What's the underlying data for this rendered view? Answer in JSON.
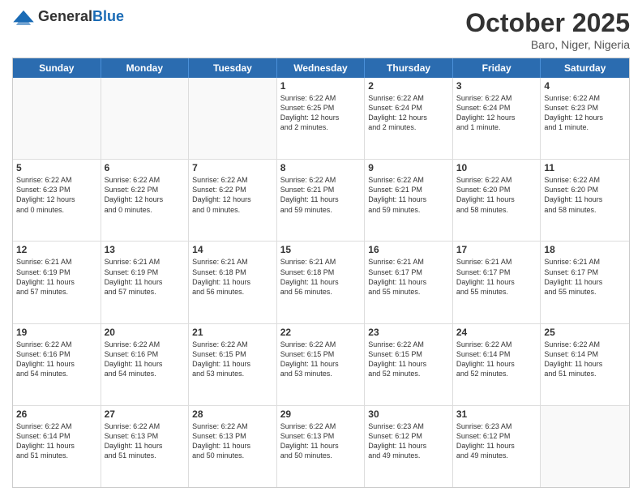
{
  "header": {
    "logo_general": "General",
    "logo_blue": "Blue",
    "title": "October 2025",
    "subtitle": "Baro, Niger, Nigeria"
  },
  "days": [
    "Sunday",
    "Monday",
    "Tuesday",
    "Wednesday",
    "Thursday",
    "Friday",
    "Saturday"
  ],
  "rows": [
    [
      {
        "day": "",
        "empty": true
      },
      {
        "day": "",
        "empty": true
      },
      {
        "day": "",
        "empty": true
      },
      {
        "day": "1",
        "text": "Sunrise: 6:22 AM\nSunset: 6:25 PM\nDaylight: 12 hours\nand 2 minutes."
      },
      {
        "day": "2",
        "text": "Sunrise: 6:22 AM\nSunset: 6:24 PM\nDaylight: 12 hours\nand 2 minutes."
      },
      {
        "day": "3",
        "text": "Sunrise: 6:22 AM\nSunset: 6:24 PM\nDaylight: 12 hours\nand 1 minute."
      },
      {
        "day": "4",
        "text": "Sunrise: 6:22 AM\nSunset: 6:23 PM\nDaylight: 12 hours\nand 1 minute."
      }
    ],
    [
      {
        "day": "5",
        "text": "Sunrise: 6:22 AM\nSunset: 6:23 PM\nDaylight: 12 hours\nand 0 minutes."
      },
      {
        "day": "6",
        "text": "Sunrise: 6:22 AM\nSunset: 6:22 PM\nDaylight: 12 hours\nand 0 minutes."
      },
      {
        "day": "7",
        "text": "Sunrise: 6:22 AM\nSunset: 6:22 PM\nDaylight: 12 hours\nand 0 minutes."
      },
      {
        "day": "8",
        "text": "Sunrise: 6:22 AM\nSunset: 6:21 PM\nDaylight: 11 hours\nand 59 minutes."
      },
      {
        "day": "9",
        "text": "Sunrise: 6:22 AM\nSunset: 6:21 PM\nDaylight: 11 hours\nand 59 minutes."
      },
      {
        "day": "10",
        "text": "Sunrise: 6:22 AM\nSunset: 6:20 PM\nDaylight: 11 hours\nand 58 minutes."
      },
      {
        "day": "11",
        "text": "Sunrise: 6:22 AM\nSunset: 6:20 PM\nDaylight: 11 hours\nand 58 minutes."
      }
    ],
    [
      {
        "day": "12",
        "text": "Sunrise: 6:21 AM\nSunset: 6:19 PM\nDaylight: 11 hours\nand 57 minutes."
      },
      {
        "day": "13",
        "text": "Sunrise: 6:21 AM\nSunset: 6:19 PM\nDaylight: 11 hours\nand 57 minutes."
      },
      {
        "day": "14",
        "text": "Sunrise: 6:21 AM\nSunset: 6:18 PM\nDaylight: 11 hours\nand 56 minutes."
      },
      {
        "day": "15",
        "text": "Sunrise: 6:21 AM\nSunset: 6:18 PM\nDaylight: 11 hours\nand 56 minutes."
      },
      {
        "day": "16",
        "text": "Sunrise: 6:21 AM\nSunset: 6:17 PM\nDaylight: 11 hours\nand 55 minutes."
      },
      {
        "day": "17",
        "text": "Sunrise: 6:21 AM\nSunset: 6:17 PM\nDaylight: 11 hours\nand 55 minutes."
      },
      {
        "day": "18",
        "text": "Sunrise: 6:21 AM\nSunset: 6:17 PM\nDaylight: 11 hours\nand 55 minutes."
      }
    ],
    [
      {
        "day": "19",
        "text": "Sunrise: 6:22 AM\nSunset: 6:16 PM\nDaylight: 11 hours\nand 54 minutes."
      },
      {
        "day": "20",
        "text": "Sunrise: 6:22 AM\nSunset: 6:16 PM\nDaylight: 11 hours\nand 54 minutes."
      },
      {
        "day": "21",
        "text": "Sunrise: 6:22 AM\nSunset: 6:15 PM\nDaylight: 11 hours\nand 53 minutes."
      },
      {
        "day": "22",
        "text": "Sunrise: 6:22 AM\nSunset: 6:15 PM\nDaylight: 11 hours\nand 53 minutes."
      },
      {
        "day": "23",
        "text": "Sunrise: 6:22 AM\nSunset: 6:15 PM\nDaylight: 11 hours\nand 52 minutes."
      },
      {
        "day": "24",
        "text": "Sunrise: 6:22 AM\nSunset: 6:14 PM\nDaylight: 11 hours\nand 52 minutes."
      },
      {
        "day": "25",
        "text": "Sunrise: 6:22 AM\nSunset: 6:14 PM\nDaylight: 11 hours\nand 51 minutes."
      }
    ],
    [
      {
        "day": "26",
        "text": "Sunrise: 6:22 AM\nSunset: 6:14 PM\nDaylight: 11 hours\nand 51 minutes."
      },
      {
        "day": "27",
        "text": "Sunrise: 6:22 AM\nSunset: 6:13 PM\nDaylight: 11 hours\nand 51 minutes."
      },
      {
        "day": "28",
        "text": "Sunrise: 6:22 AM\nSunset: 6:13 PM\nDaylight: 11 hours\nand 50 minutes."
      },
      {
        "day": "29",
        "text": "Sunrise: 6:22 AM\nSunset: 6:13 PM\nDaylight: 11 hours\nand 50 minutes."
      },
      {
        "day": "30",
        "text": "Sunrise: 6:23 AM\nSunset: 6:12 PM\nDaylight: 11 hours\nand 49 minutes."
      },
      {
        "day": "31",
        "text": "Sunrise: 6:23 AM\nSunset: 6:12 PM\nDaylight: 11 hours\nand 49 minutes."
      },
      {
        "day": "",
        "empty": true
      }
    ]
  ]
}
